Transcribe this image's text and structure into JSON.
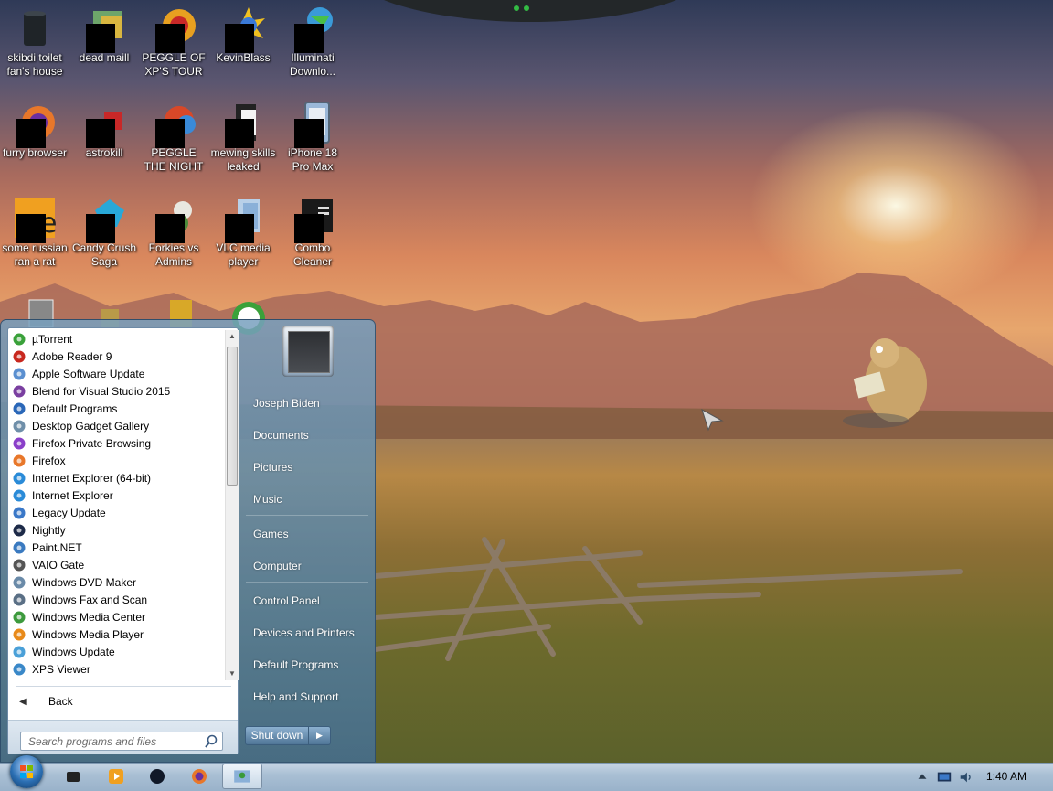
{
  "desktop": {
    "icons": [
      {
        "label": "skibdi toilet fan's house",
        "icon": "trash-can-icon"
      },
      {
        "label": "dead maill",
        "icon": "mail-icon"
      },
      {
        "label": "PEGGLE OF XP'S TOUR",
        "icon": "peggle-icon"
      },
      {
        "label": "KevinBlass",
        "icon": "sunburst-icon"
      },
      {
        "label": "Illuminati Downlo...",
        "icon": "globe-download-icon"
      },
      {
        "label": "furry browser",
        "icon": "firefox-icon"
      },
      {
        "label": "astrokill",
        "icon": "red-app-icon"
      },
      {
        "label": "PEGGLE THE NIGHT",
        "icon": "peggle-night-icon"
      },
      {
        "label": "mewing skills leaked",
        "icon": "folder-icon"
      },
      {
        "label": "iPhone 18 Pro Max",
        "icon": "phone-icon"
      },
      {
        "label": "some russian ran a rat",
        "icon": "orange-app-icon"
      },
      {
        "label": "Candy Crush Saga",
        "icon": "candy-icon"
      },
      {
        "label": "Forkies vs Admins",
        "icon": "flower-icon"
      },
      {
        "label": "VLC media player",
        "icon": "vlc-icon"
      },
      {
        "label": "Combo Cleaner",
        "icon": "cleaner-icon"
      }
    ]
  },
  "start_menu": {
    "programs": [
      {
        "label": "µTorrent",
        "color": "#3aa13a"
      },
      {
        "label": "Adobe Reader 9",
        "color": "#c8281e"
      },
      {
        "label": "Apple Software Update",
        "color": "#5a8fd0"
      },
      {
        "label": "Blend for Visual Studio 2015",
        "color": "#7a3fa0"
      },
      {
        "label": "Default Programs",
        "color": "#2a67b8"
      },
      {
        "label": "Desktop Gadget Gallery",
        "color": "#6f8fa9"
      },
      {
        "label": "Firefox Private Browsing",
        "color": "#8a3fc9"
      },
      {
        "label": "Firefox",
        "color": "#e8772a"
      },
      {
        "label": "Internet Explorer (64-bit)",
        "color": "#2a8bd8"
      },
      {
        "label": "Internet Explorer",
        "color": "#2a8bd8"
      },
      {
        "label": "Legacy Update",
        "color": "#3a78c8"
      },
      {
        "label": "Nightly",
        "color": "#1d2a48"
      },
      {
        "label": "Paint.NET",
        "color": "#3a7ac0"
      },
      {
        "label": "VAIO Gate",
        "color": "#555555"
      },
      {
        "label": "Windows DVD Maker",
        "color": "#6a8aa8"
      },
      {
        "label": "Windows Fax and Scan",
        "color": "#5a6f85"
      },
      {
        "label": "Windows Media Center",
        "color": "#3d9a3d"
      },
      {
        "label": "Windows Media Player",
        "color": "#e88a1a"
      },
      {
        "label": "Windows Update",
        "color": "#4aa0d8"
      },
      {
        "label": "XPS Viewer",
        "color": "#3a88c8"
      }
    ],
    "back_label": "Back",
    "search_placeholder": "Search programs and files",
    "user_name": "Joseph Biden",
    "right_items": {
      "documents": "Documents",
      "pictures": "Pictures",
      "music": "Music",
      "games": "Games",
      "computer": "Computer",
      "control_panel": "Control Panel",
      "devices_and_printers": "Devices and Printers",
      "default_programs": "Default Programs",
      "help_and_support": "Help and Support"
    },
    "shutdown_label": "Shut down"
  },
  "taskbar": {
    "pinned": [
      "dark-app-icon",
      "media-player-icon",
      "nightly-icon",
      "firefox-icon",
      "active-window-icon"
    ],
    "clock": "1:40 AM"
  }
}
